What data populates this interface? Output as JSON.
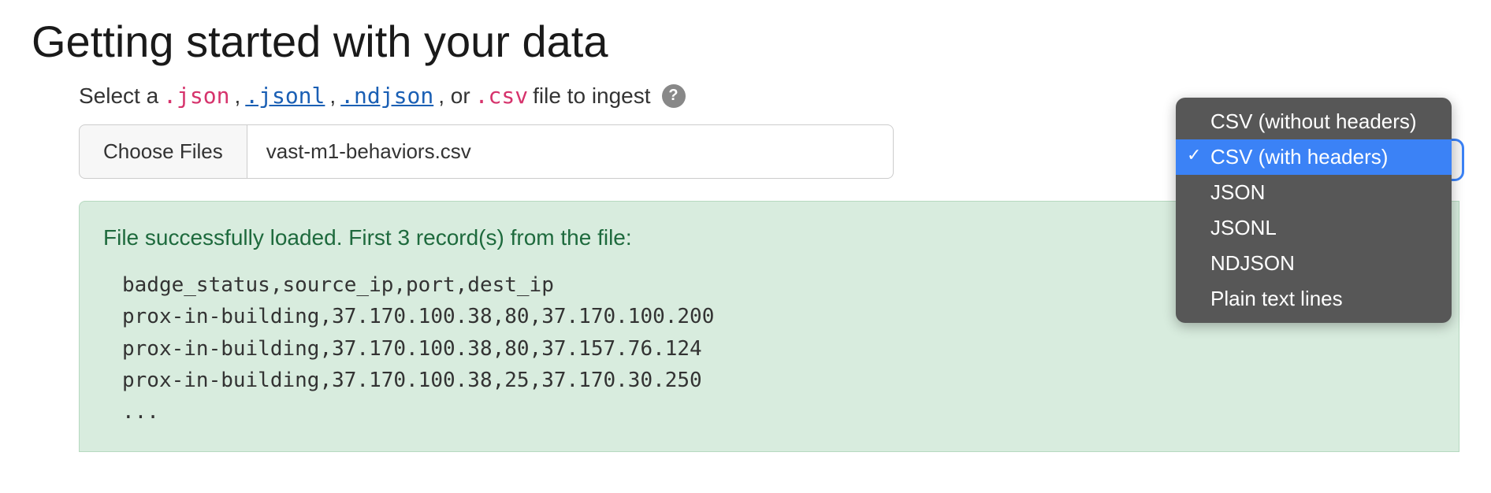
{
  "heading": "Getting started with your data",
  "instruction": {
    "prefix": "Select a ",
    "ext_json": ".json",
    "sep1": ", ",
    "ext_jsonl": ".jsonl",
    "sep2": ", ",
    "ext_ndjson": ".ndjson",
    "sep3": ", or ",
    "ext_csv": ".csv",
    "suffix": " file to ingest",
    "help": "?"
  },
  "file_input": {
    "button_label": "Choose Files",
    "filename": "vast-m1-behaviors.csv"
  },
  "success": {
    "message": "File successfully loaded. First 3 record(s) from the file:",
    "preview": "badge_status,source_ip,port,dest_ip\nprox-in-building,37.170.100.38,80,37.170.100.200\nprox-in-building,37.170.100.38,80,37.157.76.124\nprox-in-building,37.170.100.38,25,37.170.30.250\n..."
  },
  "dropdown": {
    "selected_index": 1,
    "options": [
      "CSV (without headers)",
      "CSV (with headers)",
      "JSON",
      "JSONL",
      "NDJSON",
      "Plain text lines"
    ]
  }
}
